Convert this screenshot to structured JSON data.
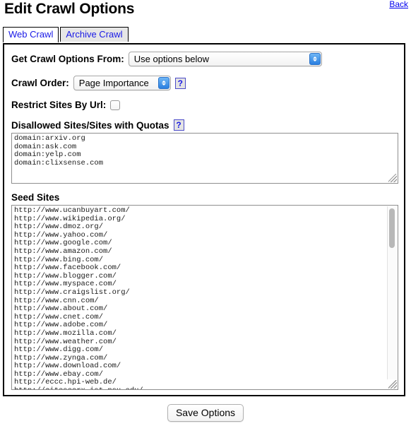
{
  "header": {
    "title": "Edit Crawl Options",
    "back_label": "Back"
  },
  "tabs": [
    {
      "label": "Web Crawl",
      "active": true
    },
    {
      "label": "Archive Crawl",
      "active": false
    }
  ],
  "form": {
    "crawl_options_from": {
      "label": "Get Crawl Options From:",
      "value": "Use options below"
    },
    "crawl_order": {
      "label": "Crawl Order:",
      "value": "Page Importance",
      "help_label": "?"
    },
    "restrict_sites_by_url": {
      "label": "Restrict Sites By Url:",
      "checked": false
    },
    "disallowed_sites": {
      "label": "Disallowed Sites/Sites with Quotas",
      "help_label": "?",
      "value": "domain:arxiv.org\ndomain:ask.com\ndomain:yelp.com\ndomain:clixsense.com"
    },
    "seed_sites": {
      "label": "Seed Sites",
      "value": "http://www.ucanbuyart.com/\nhttp://www.wikipedia.org/\nhttp://www.dmoz.org/\nhttp://www.yahoo.com/\nhttp://www.google.com/\nhttp://www.amazon.com/\nhttp://www.bing.com/\nhttp://www.facebook.com/\nhttp://www.blogger.com/\nhttp://www.myspace.com/\nhttp://www.craigslist.org/\nhttp://www.cnn.com/\nhttp://www.about.com/\nhttp://www.cnet.com/\nhttp://www.adobe.com/\nhttp://www.mozilla.com/\nhttp://www.weather.com/\nhttp://www.digg.com/\nhttp://www.zynga.com/\nhttp://www.download.com/\nhttp://www.ebay.com/\nhttp://eccc.hpi-web.de/\nhttp://citeseerx.ist.psu.edu/\nhttp://www.archive.org/\nhttp://www.imdb.com/\nhttp://www.zillow.com/"
    }
  },
  "footer": {
    "save_label": "Save Options"
  },
  "colors": {
    "link": "#0000ee",
    "tab_text": "#1919e6",
    "accent_blue": "#2a7fe0"
  }
}
